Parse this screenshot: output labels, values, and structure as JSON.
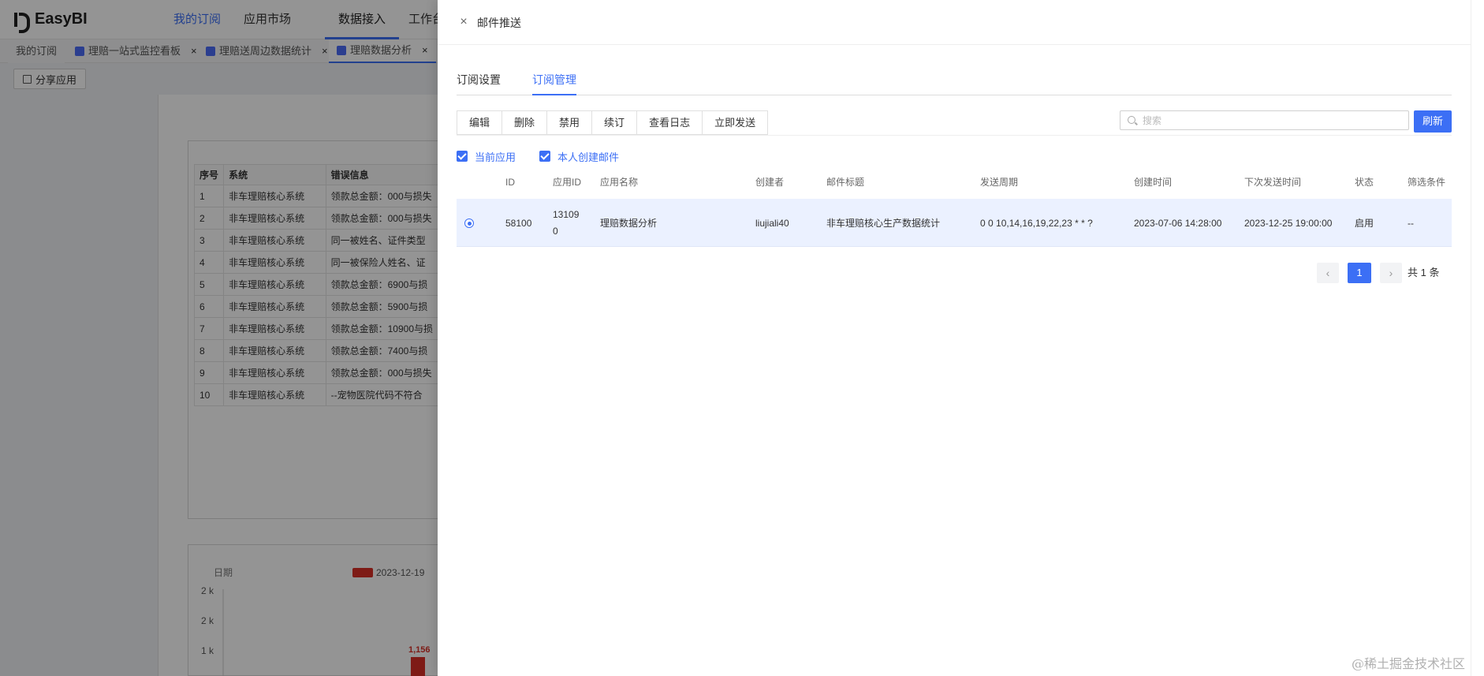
{
  "app": {
    "logo": "EasyBI",
    "nav": [
      "我的订阅",
      "应用市场",
      "数据接入",
      "工作台"
    ],
    "tabs": [
      {
        "label": "我的订阅"
      },
      {
        "label": "理赔一站式监控看板",
        "close": "×"
      },
      {
        "label": "理赔送周边数据统计",
        "close": "×"
      },
      {
        "label": "理赔数据分析",
        "close": "×"
      }
    ],
    "share_label": "分享应用",
    "bg_table": {
      "headers": [
        "序号",
        "系统",
        "错误信息"
      ],
      "rows": [
        [
          "1",
          "非车理赔核心系统",
          "领款总金额：000与损失"
        ],
        [
          "2",
          "非车理赔核心系统",
          "领款总金额：000与损失"
        ],
        [
          "3",
          "非车理赔核心系统",
          "同一被姓名、证件类型"
        ],
        [
          "4",
          "非车理赔核心系统",
          "同一被保险人姓名、证"
        ],
        [
          "5",
          "非车理赔核心系统",
          "领款总金额：6900与损"
        ],
        [
          "6",
          "非车理赔核心系统",
          "领款总金额：5900与损"
        ],
        [
          "7",
          "非车理赔核心系统",
          "领款总金额：10900与损"
        ],
        [
          "8",
          "非车理赔核心系统",
          "领款总金额：7400与损"
        ],
        [
          "9",
          "非车理赔核心系统",
          "领款总金额：000与损失"
        ],
        [
          "10",
          "非车理赔核心系统",
          "--宠物医院代码不符合"
        ]
      ]
    },
    "chart": {
      "xlabel": "日期",
      "legend": "2023-12-19",
      "ticks": [
        "2 k",
        "2 k",
        "1 k"
      ],
      "bar_label": "1,156"
    }
  },
  "drawer": {
    "title": "邮件推送",
    "close_icon": "×",
    "tabs": [
      "订阅设置",
      "订阅管理"
    ],
    "active_tab": 1,
    "toolbar": [
      "编辑",
      "删除",
      "禁用",
      "续订",
      "查看日志",
      "立即发送"
    ],
    "search_placeholder": "搜索",
    "refresh_label": "刷新",
    "checks": [
      "当前应用",
      "本人创建邮件"
    ],
    "columns": [
      "ID",
      "应用ID",
      "应用名称",
      "创建者",
      "邮件标题",
      "发送周期",
      "创建时间",
      "下次发送时间",
      "状态",
      "筛选条件"
    ],
    "row": {
      "id": "58100",
      "app_id": "131090",
      "app_name": "理赔数据分析",
      "creator": "liujiali40",
      "subject": "非车理赔核心生产数据统计",
      "cron": "0 0 10,14,16,19,22,23 * * ?",
      "created": "2023-07-06 14:28:00",
      "next_send": "2023-12-25 19:00:00",
      "status": "启用",
      "filter": "--"
    },
    "pagination": {
      "prev": "‹",
      "page": "1",
      "next": "›",
      "total": "共 1 条"
    }
  },
  "watermark": "@稀土掘金技术社区",
  "colors": {
    "accent": "#3c6ff5",
    "row_selected": "#ebf1ff",
    "overlay": "rgba(0,0,0,0.42)",
    "bar": "#d93026"
  }
}
